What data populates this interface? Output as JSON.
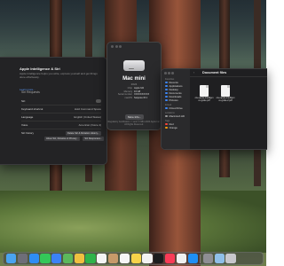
{
  "settings_window": {
    "ai_title": "Apple Intelligence & Siri",
    "ai_description": "Apple Intelligence helps you write, express yourself and get things done effortlessly.",
    "ai_link": "Learn more...",
    "section_title": "Siri Requests",
    "rows": [
      {
        "label": "Siri",
        "value": ""
      },
      {
        "label": "Keyboard shortcut",
        "value": "Hold Command Space"
      },
      {
        "label": "Language",
        "value": "English (United States)"
      },
      {
        "label": "Voice",
        "value": "American (Voice 4)"
      },
      {
        "label": "Siri history",
        "value": "Delete Siri & Dictation History..."
      }
    ],
    "button_left": "About Siri, Dictation & Privacy...",
    "button_right": "Siri Responses..."
  },
  "about_window": {
    "title": "Mac mini",
    "subtitle": "2024",
    "specs": [
      {
        "key": "Chip",
        "value": "Apple M4"
      },
      {
        "key": "Memory",
        "value": "16 GB"
      },
      {
        "key": "Serial number",
        "value": "XXXXXXXXXX"
      },
      {
        "key": "macOS",
        "value": "Sequoia 15.1"
      }
    ],
    "more_info": "More Info...",
    "footer": "Regulatory Certification ™ and © 1983–2024 Apple Inc. All Rights Reserved."
  },
  "finder_window": {
    "title": "Document files",
    "favorites_label": "Favorites",
    "favorites": [
      "Recents",
      "Applications",
      "Desktop",
      "Documents",
      "Downloads",
      "Pictures"
    ],
    "icloud_label": "iCloud",
    "icloud": [
      "iCloud Drive"
    ],
    "locations_label": "Locations",
    "locations": [
      "Macintosh HD"
    ],
    "tags_label": "Tags",
    "tags": [
      "Red",
      "Orange"
    ],
    "files": [
      {
        "name": "one-apple-intelligence-guide.pdf"
      },
      {
        "name": "one-apple-intelligence-guide-2.pdf"
      }
    ]
  },
  "dock": {
    "apps": [
      {
        "name": "Finder",
        "color": "#4aa3f0"
      },
      {
        "name": "Launchpad",
        "color": "#6e6e78"
      },
      {
        "name": "Safari",
        "color": "#2f8df4"
      },
      {
        "name": "Messages",
        "color": "#34c759"
      },
      {
        "name": "Mail",
        "color": "#3b82f6"
      },
      {
        "name": "Maps",
        "color": "#5cb85c"
      },
      {
        "name": "Photos",
        "color": "#f0c040"
      },
      {
        "name": "FaceTime",
        "color": "#2fb34a"
      },
      {
        "name": "Calendar",
        "color": "#f4f4f4"
      },
      {
        "name": "Contacts",
        "color": "#c79a6a"
      },
      {
        "name": "Reminders",
        "color": "#f5f5f5"
      },
      {
        "name": "Notes",
        "color": "#f7d34a"
      },
      {
        "name": "Freeform",
        "color": "#f2f2f2"
      },
      {
        "name": "TV",
        "color": "#1c1c1e"
      },
      {
        "name": "Music",
        "color": "#fa3b57"
      },
      {
        "name": "News",
        "color": "#f0f0f0"
      },
      {
        "name": "App Store",
        "color": "#1f8ff5"
      },
      {
        "name": "System Settings",
        "color": "#8e8e93"
      },
      {
        "name": "Preview",
        "color": "#8fbfe8"
      },
      {
        "name": "Trash",
        "color": "#c7c7cc"
      }
    ]
  }
}
